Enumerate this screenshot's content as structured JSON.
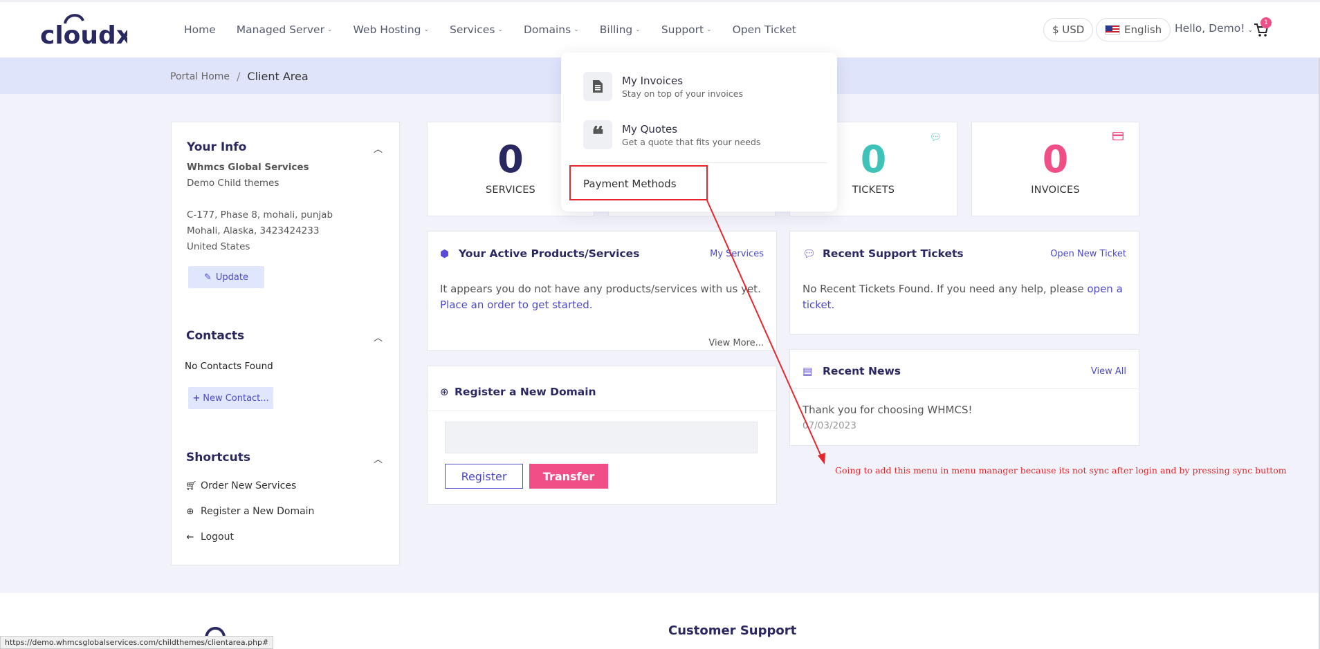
{
  "header": {
    "logo_text": "cloudx",
    "nav": [
      {
        "label": "Home",
        "caret": false
      },
      {
        "label": "Managed Server",
        "caret": true
      },
      {
        "label": "Web Hosting",
        "caret": true
      },
      {
        "label": "Services",
        "caret": true
      },
      {
        "label": "Domains",
        "caret": true
      },
      {
        "label": "Billing",
        "caret": true
      },
      {
        "label": "Support",
        "caret": true
      },
      {
        "label": "Open Ticket",
        "caret": false
      }
    ],
    "currency": "$ USD",
    "language": "English",
    "greeting": "Hello, Demo!",
    "cart_count": "1"
  },
  "breadcrumb": {
    "home": "Portal Home",
    "current": "Client Area"
  },
  "sidebar": {
    "your_info": {
      "title": "Your Info",
      "company": "Whmcs Global Services",
      "name": "Demo Child themes",
      "address1": "C-177, Phase 8, mohali, punjab",
      "address2": "Mohali, Alaska, 3423424233",
      "country": "United States",
      "update_label": "Update"
    },
    "contacts": {
      "title": "Contacts",
      "empty": "No Contacts Found",
      "new_label": "New Contact..."
    },
    "shortcuts": {
      "title": "Shortcuts",
      "items": [
        {
          "label": "Order New Services",
          "icon": "cart-icon"
        },
        {
          "label": "Register a New Domain",
          "icon": "globe-icon"
        },
        {
          "label": "Logout",
          "icon": "arrow-left-icon"
        }
      ]
    }
  },
  "tiles": [
    {
      "value": "0",
      "label": "SERVICES",
      "color": "#2a2860"
    },
    {
      "value": "0",
      "label": "TICKETS",
      "color": "#3fc3b8"
    },
    {
      "value": "0",
      "label": "INVOICES",
      "color": "#ef4f86"
    }
  ],
  "cards": {
    "products": {
      "title": "Your Active Products/Services",
      "link": "My Services",
      "text": "It appears you do not have any products/services with us yet.",
      "order_link": "Place an order to get started.",
      "view_more": "View More..."
    },
    "tickets": {
      "title": "Recent Support Tickets",
      "link": "Open New Ticket",
      "text": "No Recent Tickets Found. If you need any help, please",
      "link2": "open a ticket."
    },
    "domain": {
      "title": "Register a New Domain",
      "register": "Register",
      "transfer": "Transfer"
    },
    "news": {
      "title": "Recent News",
      "link": "View All",
      "headline": "Thank you for choosing WHMCS!",
      "date": "07/03/2023"
    }
  },
  "billing_menu": {
    "items": [
      {
        "title": "My Invoices",
        "subtitle": "Stay on top of your invoices"
      },
      {
        "title": "My Quotes",
        "subtitle": "Get a quote that fits your needs"
      }
    ],
    "payment_methods": "Payment Methods"
  },
  "annotation": "Going to add this menu in menu manager because its not sync after login and by pressing sync buttom",
  "footer": {
    "title": "Customer Support"
  },
  "status_url": "https://demo.whmcsglobalservices.com/childthemes/clientarea.php#",
  "colors": {
    "accent": "#4b49c9",
    "navy": "#2a2860",
    "pink": "#ef4f86",
    "teal": "#3fc3b8",
    "annotation": "#e6262c"
  }
}
